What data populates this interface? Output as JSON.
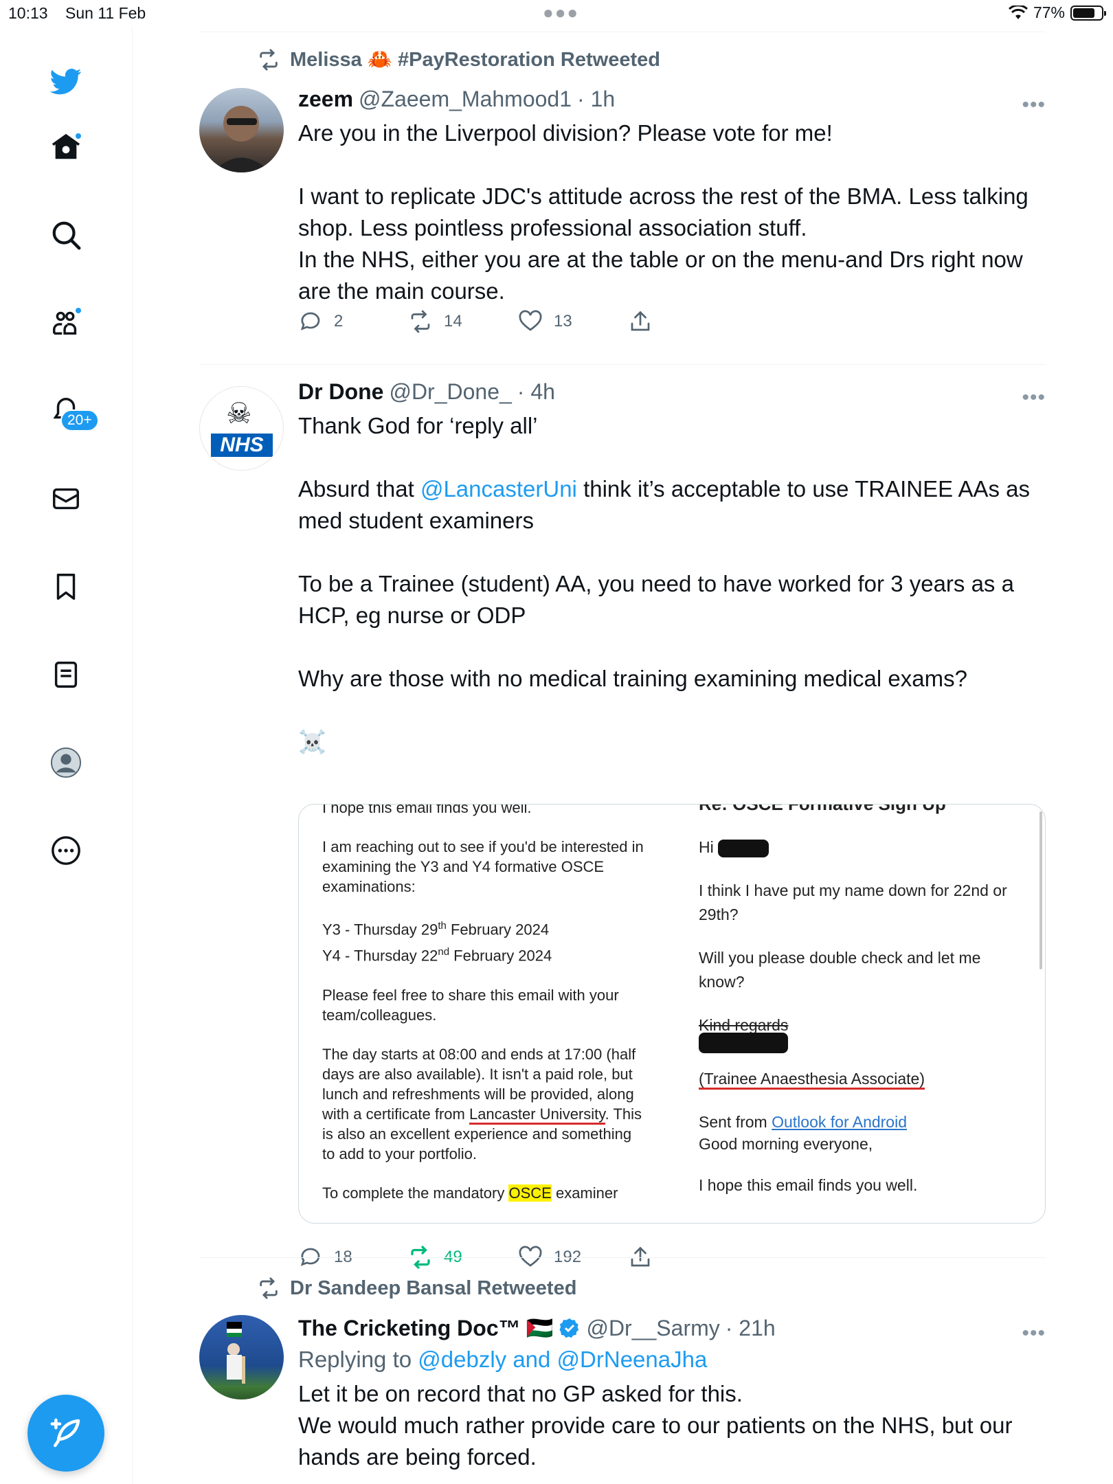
{
  "status_bar": {
    "time": "10:13",
    "date": "Sun 11 Feb",
    "battery": "77%",
    "battery_level": 0.77
  },
  "sidebar": {
    "items": [
      {
        "icon": "twitter-bird-icon"
      },
      {
        "icon": "home-icon",
        "has_dot": true
      },
      {
        "icon": "search-icon"
      },
      {
        "icon": "communities-icon",
        "has_dot": true
      },
      {
        "icon": "notifications-bell-icon",
        "badge": "20+"
      },
      {
        "icon": "messages-envelope-icon"
      },
      {
        "icon": "bookmark-icon"
      },
      {
        "icon": "lists-icon"
      },
      {
        "icon": "profile-avatar-icon"
      },
      {
        "icon": "more-circle-icon"
      }
    ],
    "compose_icon": "compose-feather-icon"
  },
  "tweets": [
    {
      "retweet_by": "Melissa 🦀 #PayRestoration Retweeted",
      "name": "zeem",
      "handle": "@Zaeem_Mahmood1",
      "time": "· 1h",
      "text": "Are you in the Liverpool division? Please vote for me!\n\nI want to replicate JDC's attitude across the rest of the BMA. Less talking shop. Less pointless professional association stuff.\nIn the NHS, either you are at the table or on the menu-and Drs right now are the main course.",
      "replies": "2",
      "retweets": "14",
      "likes": "13"
    },
    {
      "name": "Dr Done",
      "handle": "@Dr_Done_",
      "time": "· 4h",
      "text_1": "Thank God for ‘reply all’\n\nAbsurd that ",
      "mention": "@LancasterUni",
      "text_2": " think it’s acceptable to use TRAINEE AAs as med student examiners\n\nTo be a Trainee (student) AA, you need to have worked for 3 years as a HCP, eg nurse or ODP\n\nWhy are those with no medical training examining medical exams?\n\n☠️",
      "avatar_text": "NHS",
      "replies": "18",
      "retweets": "49",
      "likes": "192",
      "email": {
        "left": {
          "p1": "I hope this email finds you well.",
          "p2": "I am reaching out to see if you'd be interested in examining the Y3 and Y4 formative OSCE examinations:",
          "y3_pre": "Y3 - Thursday 29",
          "y3_sup": "th",
          "y3_post": " February 2024",
          "y4_pre": "Y4 - Thursday 22",
          "y4_sup": "nd",
          "y4_post": " February 2024",
          "p4": "Please feel free to share this email with your team/colleagues.",
          "p5_a": "The day starts at 08:00 and ends at 17:00 (half days are also available). It isn't a paid role, but lunch and refreshments will be provided, along with a certificate from ",
          "p5_link": "Lancaster University",
          "p5_b": ". This is also an excellent experience and something to add to your portfolio.",
          "p6_a": "To complete the mandatory ",
          "p6_hl": "OSCE",
          "p6_b": " examiner"
        },
        "right": {
          "heading": "Re: OSCE Formative Sign Up",
          "hi": "Hi",
          "p1": "I think I have put my name down for 22nd or 29th?",
          "p2": "Will you please double check and let me know?",
          "regards": "Kind regards",
          "role": "(Trainee Anaesthesia Associate)",
          "sent_from": "Sent from ",
          "sent_link": "Outlook for Android",
          "morning": "Good morning everyone,",
          "hope": "I hope this email finds you well."
        }
      }
    },
    {
      "retweet_by": "Dr Sandeep Bansal Retweeted",
      "name": "The Cricketing Doc™",
      "flag": "🇵🇸",
      "handle": "@Dr__Sarmy",
      "time": "· 21h",
      "replying_prefix": "Replying to ",
      "replying_to": "@debzly and @DrNeenaJha",
      "text": "Let it be on record that no GP asked for this.\nWe would much rather provide care to our patients on the NHS, but our hands are being forced."
    }
  ]
}
